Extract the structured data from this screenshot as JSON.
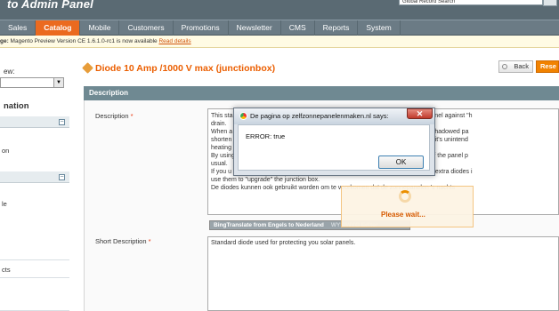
{
  "header": {
    "title": "to  Admin Panel",
    "search_value": "Global Record Search"
  },
  "nav": {
    "items": [
      {
        "label": "Sales",
        "active": false
      },
      {
        "label": "Catalog",
        "active": true
      },
      {
        "label": "Mobile",
        "active": false
      },
      {
        "label": "Customers",
        "active": false
      },
      {
        "label": "Promotions",
        "active": false
      },
      {
        "label": "Newsletter",
        "active": false
      },
      {
        "label": "CMS",
        "active": false
      },
      {
        "label": "Reports",
        "active": false
      },
      {
        "label": "System",
        "active": false
      }
    ]
  },
  "notice": {
    "label": "ge:",
    "text": " Magento Preview Version CE 1.6.1.0-rc1 is now available ",
    "link": "Read details"
  },
  "sidebar": {
    "view_label": "ew:",
    "heading": "nation",
    "rows_a": [
      "on"
    ],
    "rows_b": [
      "le",
      "cts"
    ]
  },
  "product": {
    "title": "Diode 10 Amp /1000 V max (junctionbox)",
    "back_label": "Back",
    "reset_label": "Rese"
  },
  "section": {
    "title": "Description"
  },
  "fields": {
    "description_label": "Description",
    "description_text": "This sta                                                                        y be used te protect your panel against \"h\ndrain.\nWhen a                                                                       array or panel heats up the shadowed pa\nshorten                                                                       produce usable solar power (it's unintend\nheating\nBy using                                                                      y, but also the lighted  part of the panel p\nusual.\nIf you u                                                                      built in. You don't have to buy extra diodes i\nuse them to \"upgrade\" the junction box.\nDe diodes kunnen ook gebruikt worden om te voorkomen dat de zonnepanelen 's nachts",
    "short_label": "Short Description",
    "short_text": "Standard diode used for protecting you solar panels.",
    "required_mark": "*",
    "toolbar": [
      "BingTranslate from Engels to Nederland",
      "WYSIWYG Editor"
    ]
  },
  "wait": {
    "text": "Please wait..."
  },
  "dialog": {
    "title": "De pagina op zelfzonnepanelenmaken.nl says:",
    "message": "ERROR: true",
    "ok_label": "OK",
    "close_label": "✕"
  }
}
